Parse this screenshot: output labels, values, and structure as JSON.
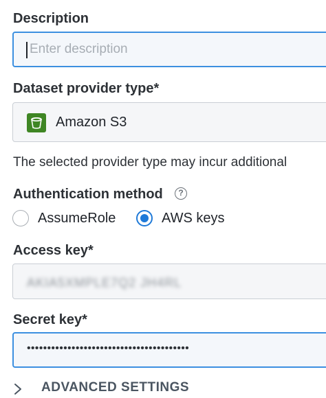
{
  "description": {
    "label": "Description",
    "value": "",
    "placeholder": "Enter description"
  },
  "provider": {
    "label": "Dataset provider type*",
    "selected": "Amazon S3",
    "icon": "amazon-s3-icon",
    "icon_color": "#3f8624",
    "note": "The selected provider type may incur additional"
  },
  "auth": {
    "label": "Authentication method",
    "help_icon": "?",
    "options": [
      {
        "label": "AssumeRole",
        "checked": false
      },
      {
        "label": "AWS keys",
        "checked": true
      }
    ]
  },
  "access_key": {
    "label": "Access key*",
    "value_obscured": "AKIA5XMPLE7Q2 JH4RL"
  },
  "secret_key": {
    "label": "Secret key*",
    "value_masked": "••••••••••••••••••••••••••••••••••••••••"
  },
  "advanced": {
    "label": "ADVANCED SETTINGS"
  },
  "colors": {
    "focus_border": "#3b8fe0",
    "radio_selected": "#1f7ad8"
  }
}
